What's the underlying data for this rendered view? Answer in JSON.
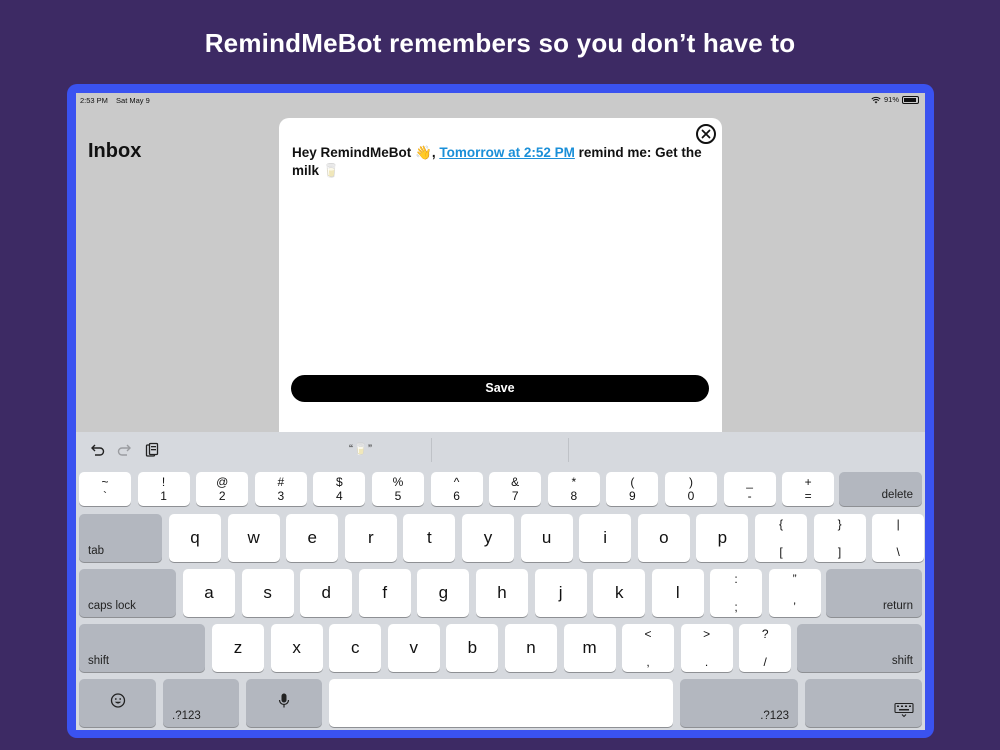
{
  "headline": "RemindMeBot remembers so you don’t have to",
  "status_bar": {
    "time": "2:53 PM",
    "date": "Sat May 9",
    "battery": "91%"
  },
  "inbox": {
    "title": "Inbox"
  },
  "modal": {
    "message_prefix": "Hey RemindMeBot 👋, ",
    "message_link": "Tomorrow at 2:52 PM",
    "message_suffix": " remind me: Get the milk 🥛",
    "save_label": "Save"
  },
  "keyboard_toolbar": {
    "suggestion": "“🥛”"
  },
  "keyboard": {
    "number_row": [
      {
        "top": "~",
        "bottom": "`"
      },
      {
        "top": "!",
        "bottom": "1"
      },
      {
        "top": "@",
        "bottom": "2"
      },
      {
        "top": "#",
        "bottom": "3"
      },
      {
        "top": "$",
        "bottom": "4"
      },
      {
        "top": "%",
        "bottom": "5"
      },
      {
        "top": "^",
        "bottom": "6"
      },
      {
        "top": "&",
        "bottom": "7"
      },
      {
        "top": "*",
        "bottom": "8"
      },
      {
        "top": "(",
        "bottom": "9"
      },
      {
        "top": ")",
        "bottom": "0"
      },
      {
        "top": "_",
        "bottom": "-"
      },
      {
        "top": "+",
        "bottom": "="
      }
    ],
    "delete_label": "delete",
    "tab_label": "tab",
    "row_q": [
      "q",
      "w",
      "e",
      "r",
      "t",
      "y",
      "u",
      "i",
      "o",
      "p"
    ],
    "row_q_symbols": [
      {
        "top": "{",
        "bottom": "["
      },
      {
        "top": "}",
        "bottom": "]"
      },
      {
        "top": "|",
        "bottom": "\\"
      }
    ],
    "caps_label": "caps lock",
    "row_a": [
      "a",
      "s",
      "d",
      "f",
      "g",
      "h",
      "j",
      "k",
      "l"
    ],
    "row_a_symbols": [
      {
        "top": ":",
        "bottom": ";"
      },
      {
        "top": "”",
        "bottom": "’"
      }
    ],
    "return_label": "return",
    "shift_label": "shift",
    "row_z": [
      "z",
      "x",
      "c",
      "v",
      "b",
      "n",
      "m"
    ],
    "row_z_symbols": [
      {
        "top": "<",
        "bottom": ","
      },
      {
        "top": ">",
        "bottom": "."
      },
      {
        "top": "?",
        "bottom": "/"
      }
    ],
    "numbers_label": ".?123",
    "icons": [
      "emoji-icon",
      "microphone-icon",
      "keyboard-dismiss-icon",
      "undo-icon",
      "redo-icon",
      "paste-icon",
      "close-icon",
      "wifi-icon"
    ]
  }
}
